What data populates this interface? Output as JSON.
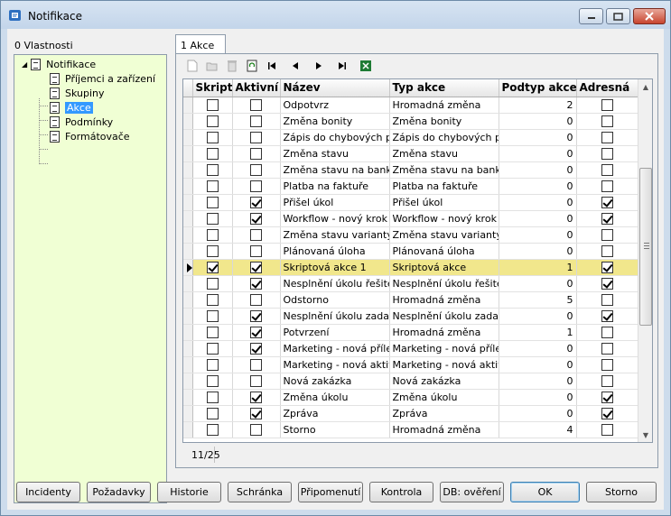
{
  "window": {
    "title": "Notifikace",
    "buttons": {
      "minimize": "▬",
      "maximize": "▢",
      "close": "✕"
    }
  },
  "left_panel": {
    "title": "0 Vlastnosti",
    "tree": {
      "root": "Notifikace",
      "items": [
        "Příjemci a zařízení",
        "Skupiny",
        "Akce",
        "Podmínky",
        "Formátovače"
      ],
      "selected": "Akce"
    }
  },
  "tab": {
    "label": "1 Akce"
  },
  "toolbar": {
    "icons": [
      "new-icon",
      "open-icon",
      "delete-icon",
      "refresh-icon",
      "first-icon",
      "prev-icon",
      "next-icon",
      "last-icon",
      "excel-icon"
    ]
  },
  "grid": {
    "columns": [
      "Skript",
      "Aktivní",
      "Název",
      "Typ akce",
      "Podtyp akce",
      "Adresná"
    ],
    "rows": [
      {
        "skript": false,
        "aktivni": false,
        "nazev": "Odpotvrz",
        "typ": "Hromadná změna",
        "podtyp": "2",
        "adresna": false
      },
      {
        "skript": false,
        "aktivni": false,
        "nazev": "Změna bonity",
        "typ": "Změna bonity",
        "podtyp": "0",
        "adresna": false
      },
      {
        "skript": false,
        "aktivni": false,
        "nazev": "Zápis do chybových prot",
        "typ": "Zápis do chybových prot",
        "podtyp": "0",
        "adresna": false
      },
      {
        "skript": false,
        "aktivni": false,
        "nazev": "Změna stavu",
        "typ": "Změna stavu",
        "podtyp": "0",
        "adresna": false
      },
      {
        "skript": false,
        "aktivni": false,
        "nazev": "Změna stavu na bankovn",
        "typ": "Změna stavu na bankovr",
        "podtyp": "0",
        "adresna": false
      },
      {
        "skript": false,
        "aktivni": false,
        "nazev": "Platba na faktuře",
        "typ": "Platba na faktuře",
        "podtyp": "0",
        "adresna": false
      },
      {
        "skript": false,
        "aktivni": true,
        "nazev": "Přišel úkol",
        "typ": "Přišel úkol",
        "podtyp": "0",
        "adresna": true
      },
      {
        "skript": false,
        "aktivni": true,
        "nazev": "Workflow - nový krok",
        "typ": "Workflow - nový krok",
        "podtyp": "0",
        "adresna": true
      },
      {
        "skript": false,
        "aktivni": false,
        "nazev": "Změna stavu varianty TP",
        "typ": "Změna stavu varianty TP",
        "podtyp": "0",
        "adresna": false
      },
      {
        "skript": false,
        "aktivni": false,
        "nazev": "Plánovaná úloha",
        "typ": "Plánovaná úloha",
        "podtyp": "0",
        "adresna": false
      },
      {
        "skript": true,
        "aktivni": true,
        "nazev": "Skriptová akce 1",
        "typ": "Skriptová akce",
        "podtyp": "1",
        "adresna": true
      },
      {
        "skript": false,
        "aktivni": true,
        "nazev": "Nesplnění úkolu řešiteli",
        "typ": "Nesplnění úkolu řešiteli",
        "podtyp": "0",
        "adresna": true
      },
      {
        "skript": false,
        "aktivni": false,
        "nazev": "Odstorno",
        "typ": "Hromadná změna",
        "podtyp": "5",
        "adresna": false
      },
      {
        "skript": false,
        "aktivni": true,
        "nazev": "Nesplnění úkolu zadavate",
        "typ": "Nesplnění úkolu zadavate",
        "podtyp": "0",
        "adresna": true
      },
      {
        "skript": false,
        "aktivni": true,
        "nazev": "Potvrzení",
        "typ": "Hromadná změna",
        "podtyp": "1",
        "adresna": false
      },
      {
        "skript": false,
        "aktivni": true,
        "nazev": "Marketing - nová příležito",
        "typ": "Marketing - nová příležito",
        "podtyp": "0",
        "adresna": false
      },
      {
        "skript": false,
        "aktivni": false,
        "nazev": "Marketing - nová aktivita",
        "typ": "Marketing - nová aktivita",
        "podtyp": "0",
        "adresna": false
      },
      {
        "skript": false,
        "aktivni": false,
        "nazev": "Nová zakázka",
        "typ": "Nová zakázka",
        "podtyp": "0",
        "adresna": false
      },
      {
        "skript": false,
        "aktivni": true,
        "nazev": "Změna úkolu",
        "typ": "Změna úkolu",
        "podtyp": "0",
        "adresna": true
      },
      {
        "skript": false,
        "aktivni": true,
        "nazev": "Zpráva",
        "typ": "Zpráva",
        "podtyp": "0",
        "adresna": true
      },
      {
        "skript": false,
        "aktivni": false,
        "nazev": "Storno",
        "typ": "Hromadná změna",
        "podtyp": "4",
        "adresna": false
      }
    ],
    "selected_index": 10
  },
  "status": {
    "record_position": "11/25"
  },
  "buttons": [
    "Incidenty",
    "Požadavky",
    "Historie",
    "Schránka",
    "Připomenutí",
    "Kontrola",
    "DB: ověření",
    "OK",
    "Storno"
  ]
}
